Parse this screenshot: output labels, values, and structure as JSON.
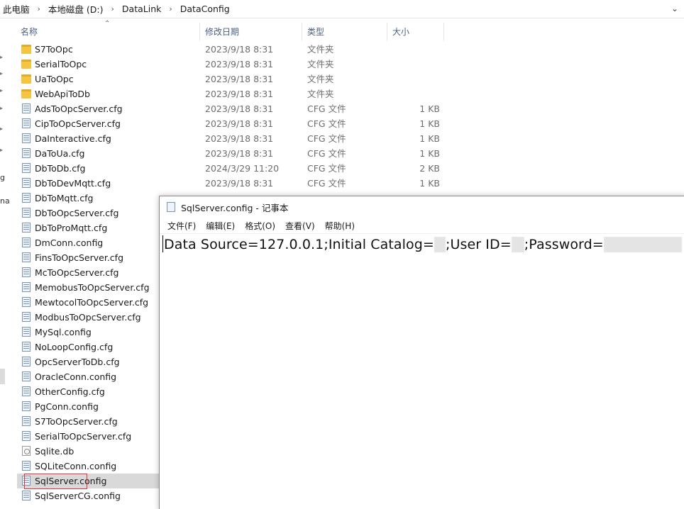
{
  "address_bar": {
    "crumbs": [
      "此电脑",
      "本地磁盘 (D:)",
      "DataLink",
      "DataConfig"
    ],
    "separator": "›",
    "dropdown_icon": "chevron-down-icon"
  },
  "nav_fragments": [
    "g",
    "na"
  ],
  "columns": {
    "name": "名称",
    "date": "修改日期",
    "type": "类型",
    "size": "大小"
  },
  "files": [
    {
      "name": "S7ToOpc",
      "date": "2023/9/18 8:31",
      "type": "文件夹",
      "size": "",
      "icon": "folder-icon"
    },
    {
      "name": "SerialToOpc",
      "date": "2023/9/18 8:31",
      "type": "文件夹",
      "size": "",
      "icon": "folder-icon"
    },
    {
      "name": "UaToOpc",
      "date": "2023/9/18 8:31",
      "type": "文件夹",
      "size": "",
      "icon": "folder-icon"
    },
    {
      "name": "WebApiToDb",
      "date": "2023/9/18 8:31",
      "type": "文件夹",
      "size": "",
      "icon": "folder-icon"
    },
    {
      "name": "AdsToOpcServer.cfg",
      "date": "2023/9/18 8:31",
      "type": "CFG 文件",
      "size": "1 KB",
      "icon": "cfg-file-icon"
    },
    {
      "name": "CipToOpcServer.cfg",
      "date": "2023/9/18 8:31",
      "type": "CFG 文件",
      "size": "1 KB",
      "icon": "cfg-file-icon"
    },
    {
      "name": "DaInteractive.cfg",
      "date": "2023/9/18 8:31",
      "type": "CFG 文件",
      "size": "1 KB",
      "icon": "cfg-file-icon"
    },
    {
      "name": "DaToUa.cfg",
      "date": "2023/9/18 8:31",
      "type": "CFG 文件",
      "size": "1 KB",
      "icon": "cfg-file-icon"
    },
    {
      "name": "DbToDb.cfg",
      "date": "2024/3/29 11:20",
      "type": "CFG 文件",
      "size": "2 KB",
      "icon": "cfg-file-icon"
    },
    {
      "name": "DbToDevMqtt.cfg",
      "date": "2023/9/18 8:31",
      "type": "CFG 文件",
      "size": "1 KB",
      "icon": "cfg-file-icon"
    },
    {
      "name": "DbToMqtt.cfg",
      "date": "",
      "type": "",
      "size": "",
      "icon": "cfg-file-icon"
    },
    {
      "name": "DbToOpcServer.cfg",
      "date": "",
      "type": "",
      "size": "",
      "icon": "cfg-file-icon"
    },
    {
      "name": "DbToProMqtt.cfg",
      "date": "",
      "type": "",
      "size": "",
      "icon": "cfg-file-icon"
    },
    {
      "name": "DmConn.config",
      "date": "",
      "type": "",
      "size": "",
      "icon": "cfg-file-icon"
    },
    {
      "name": "FinsToOpcServer.cfg",
      "date": "",
      "type": "",
      "size": "",
      "icon": "cfg-file-icon"
    },
    {
      "name": "McToOpcServer.cfg",
      "date": "",
      "type": "",
      "size": "",
      "icon": "cfg-file-icon"
    },
    {
      "name": "MemobusToOpcServer.cfg",
      "date": "",
      "type": "",
      "size": "",
      "icon": "cfg-file-icon"
    },
    {
      "name": "MewtocolToOpcServer.cfg",
      "date": "",
      "type": "",
      "size": "",
      "icon": "cfg-file-icon"
    },
    {
      "name": "ModbusToOpcServer.cfg",
      "date": "",
      "type": "",
      "size": "",
      "icon": "cfg-file-icon"
    },
    {
      "name": "MySql.config",
      "date": "",
      "type": "",
      "size": "",
      "icon": "cfg-file-icon"
    },
    {
      "name": "NoLoopConfig.cfg",
      "date": "",
      "type": "",
      "size": "",
      "icon": "cfg-file-icon"
    },
    {
      "name": "OpcServerToDb.cfg",
      "date": "",
      "type": "",
      "size": "",
      "icon": "cfg-file-icon"
    },
    {
      "name": "OracleConn.config",
      "date": "",
      "type": "",
      "size": "",
      "icon": "cfg-file-icon"
    },
    {
      "name": "OtherConfig.cfg",
      "date": "",
      "type": "",
      "size": "",
      "icon": "cfg-file-icon"
    },
    {
      "name": "PgConn.config",
      "date": "",
      "type": "",
      "size": "",
      "icon": "cfg-file-icon"
    },
    {
      "name": "S7ToOpcServer.cfg",
      "date": "",
      "type": "",
      "size": "",
      "icon": "cfg-file-icon"
    },
    {
      "name": "SerialToOpcServer.cfg",
      "date": "",
      "type": "",
      "size": "",
      "icon": "cfg-file-icon"
    },
    {
      "name": "Sqlite.db",
      "date": "",
      "type": "",
      "size": "",
      "icon": "db-file-icon"
    },
    {
      "name": "SQLiteConn.config",
      "date": "",
      "type": "",
      "size": "",
      "icon": "cfg-file-icon"
    },
    {
      "name": "SqlServer.config",
      "date": "",
      "type": "",
      "size": "",
      "icon": "cfg-file-icon",
      "selected": true
    },
    {
      "name": "SqlServerCG.config",
      "date": "",
      "type": "",
      "size": "",
      "icon": "cfg-file-icon"
    }
  ],
  "notepad": {
    "title": "SqlServer.config - 记事本",
    "menus": [
      "文件(F)",
      "编辑(E)",
      "格式(O)",
      "查看(V)",
      "帮助(H)"
    ],
    "content": {
      "part1": "Data Source=127.0.0.1;Initial Catalog=",
      "part2": ";User ID=",
      "part3": ";Password="
    }
  }
}
